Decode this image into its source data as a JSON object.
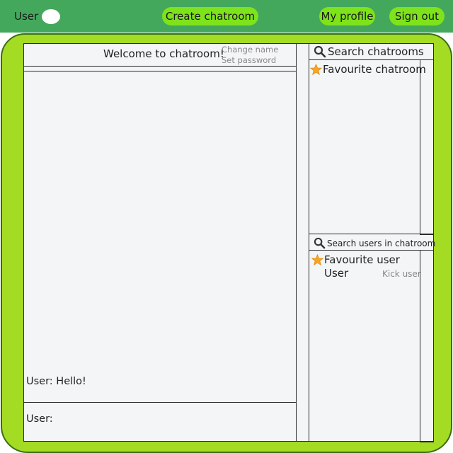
{
  "topbar": {
    "user_label": "User",
    "create_chatroom": "Create chatroom",
    "my_profile": "My profile",
    "sign_out": "Sign out"
  },
  "chat": {
    "welcome": "Welcome to chatroom!",
    "change_name": "Change name",
    "set_password": "Set password",
    "messages": [
      {
        "text": "User: Hello!"
      }
    ],
    "input_label": "User:"
  },
  "sidebar": {
    "search_chatrooms": "Search chatrooms",
    "favourite_chatroom": "Favourite chatroom",
    "search_users": "Search users in chatroom",
    "favourite_user": "Favourite user",
    "user_name": "User",
    "kick_user": "Kick user"
  },
  "colors": {
    "topbar_bg": "#44a85c",
    "button_bg": "#7ee31b",
    "frame_bg": "#a3dc22",
    "panel_bg": "#f4f5f7",
    "star": "#f5a623"
  }
}
